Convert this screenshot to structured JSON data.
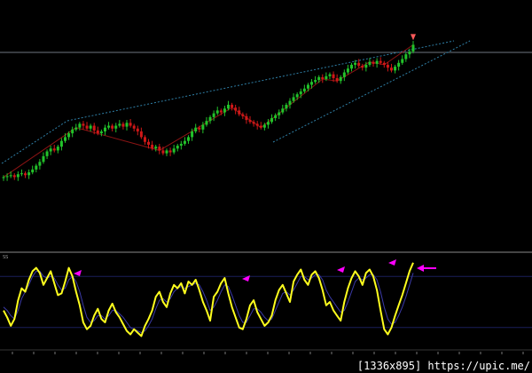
{
  "watermark": "[1336x895] https://upic.me/",
  "oscillator_label": "SS",
  "colors": {
    "background": "#000000",
    "candle_up": "#22c22a",
    "candle_down": "#d01818",
    "trendline": "#2f7fa6",
    "zigzag": "#8b1414",
    "oscillator_main": "#ffff1e",
    "oscillator_signal": "#3b3aa8",
    "marker": "#ff00ff"
  },
  "chart_data": [
    {
      "type": "candlestick",
      "title": "",
      "notes": "Price chart in an uptrend with a rising channel (dotted trendlines), a horizontal line near the top and a zigzag overlay.",
      "closes": [
        198,
        199,
        200,
        198,
        201,
        202,
        200,
        203,
        206,
        210,
        214,
        220,
        225,
        228,
        226,
        230,
        236,
        240,
        244,
        248,
        250,
        254,
        252,
        249,
        252,
        247,
        244,
        246,
        250,
        252,
        249,
        252,
        254,
        251,
        255,
        252,
        249,
        246,
        240,
        235,
        232,
        228,
        230,
        226,
        223,
        226,
        224,
        228,
        231,
        233,
        236,
        240,
        246,
        250,
        248,
        253,
        257,
        261,
        265,
        268,
        266,
        270,
        274,
        271,
        268,
        264,
        262,
        258,
        256,
        254,
        252,
        250,
        253,
        256,
        260,
        263,
        266,
        270,
        274,
        278,
        282,
        285,
        288,
        291,
        295,
        298,
        300,
        303,
        301,
        304,
        306,
        302,
        299,
        303,
        308,
        312,
        316,
        318,
        315,
        313,
        316,
        319,
        317,
        320,
        318,
        316,
        313,
        310,
        314,
        318,
        322,
        327,
        330,
        337
      ]
    },
    {
      "type": "line",
      "title": "",
      "series": [
        {
          "values": [
            40,
            32,
            22,
            30,
            52,
            66,
            62,
            76,
            86,
            90,
            84,
            70,
            78,
            86,
            72,
            58,
            60,
            74,
            90,
            80,
            62,
            46,
            26,
            18,
            22,
            34,
            42,
            30,
            26,
            40,
            48,
            38,
            32,
            24,
            16,
            12,
            18,
            14,
            10,
            22,
            30,
            40,
            56,
            62,
            50,
            44,
            60,
            70,
            66,
            72,
            60,
            74,
            70,
            76,
            64,
            50,
            40,
            28,
            56,
            62,
            72,
            78,
            60,
            44,
            32,
            20,
            18,
            30,
            46,
            52,
            38,
            30,
            22,
            26,
            34,
            52,
            64,
            70,
            60,
            50,
            74,
            82,
            88,
            76,
            70,
            82,
            86,
            78,
            64,
            46,
            50,
            40,
            34,
            28,
            50,
            66,
            78,
            86,
            80,
            70,
            84,
            88,
            80,
            64,
            40,
            18,
            12,
            20,
            34,
            46,
            58,
            72,
            86,
            96
          ]
        },
        {
          "values": [
            44,
            40,
            34,
            30,
            40,
            54,
            62,
            70,
            80,
            86,
            86,
            80,
            78,
            80,
            78,
            70,
            64,
            66,
            76,
            80,
            74,
            62,
            46,
            32,
            26,
            28,
            34,
            34,
            30,
            34,
            40,
            40,
            36,
            32,
            26,
            20,
            18,
            16,
            14,
            16,
            22,
            30,
            42,
            52,
            54,
            50,
            54,
            62,
            66,
            68,
            66,
            68,
            70,
            72,
            70,
            62,
            52,
            40,
            44,
            52,
            62,
            70,
            68,
            58,
            46,
            34,
            26,
            26,
            34,
            42,
            42,
            38,
            32,
            28,
            30,
            40,
            50,
            60,
            62,
            58,
            64,
            72,
            80,
            80,
            76,
            78,
            82,
            82,
            76,
            64,
            56,
            50,
            44,
            38,
            40,
            50,
            62,
            74,
            78,
            76,
            78,
            82,
            82,
            76,
            62,
            44,
            30,
            24,
            26,
            34,
            44,
            56,
            70,
            84
          ]
        }
      ],
      "ylim": [
        0,
        100
      ]
    }
  ]
}
